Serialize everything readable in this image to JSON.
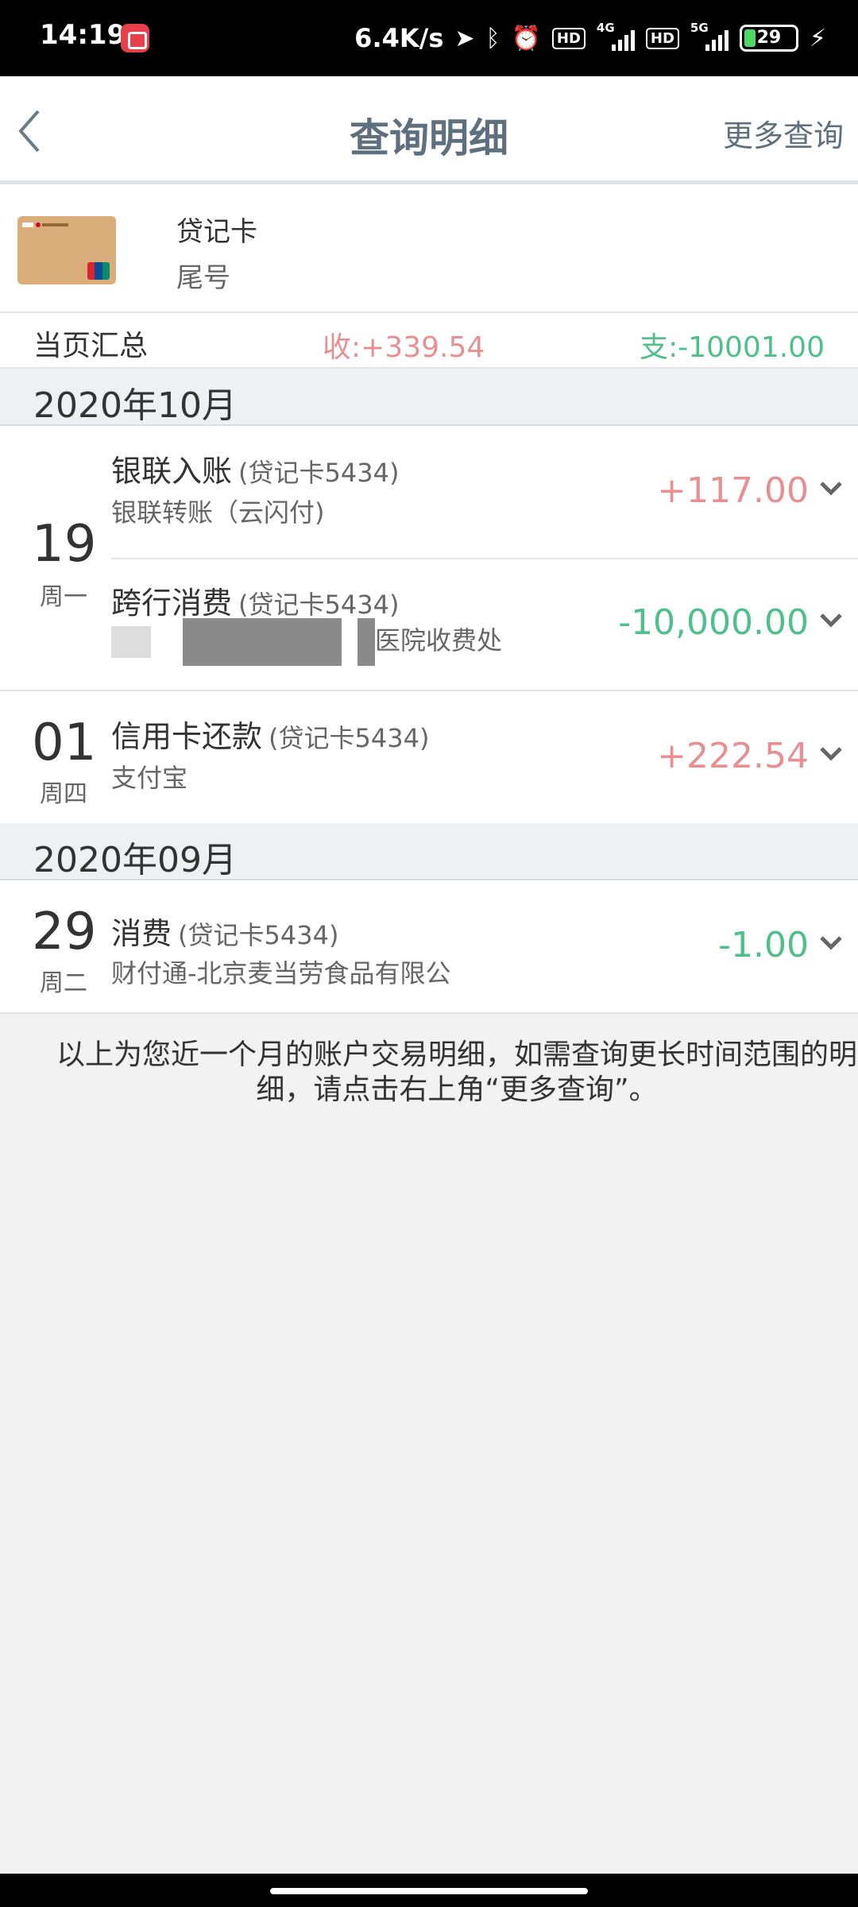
{
  "status_bar": {
    "time": "14:19",
    "speed": "6.4K/s",
    "hd1": "HD",
    "net1": "4G",
    "hd2": "HD",
    "net2": "5G",
    "battery": "29",
    "battery_level": 0.29,
    "icons": [
      "location-icon",
      "bluetooth-icon",
      "alarm-icon",
      "charging-icon"
    ]
  },
  "nav": {
    "title": "查询明细",
    "more_label": "更多查询"
  },
  "card": {
    "type": "贷记卡",
    "tail_label": "尾号"
  },
  "summary": {
    "label": "当页汇总",
    "income": "收:+339.54",
    "expense": "支:-10001.00"
  },
  "months": [
    {
      "label": "2020年10月",
      "days": [
        {
          "day": "19",
          "weekday": "周一",
          "transactions": [
            {
              "title": "银联入账",
              "card": "(贷记卡5434)",
              "desc": "银联转账（云闪付)",
              "amount": "+117.00",
              "kind": "income"
            },
            {
              "title": "跨行消费",
              "card": "(贷记卡5434)",
              "desc": "医院收费处",
              "amount": "-10,000.00",
              "kind": "expense"
            }
          ]
        },
        {
          "day": "01",
          "weekday": "周四",
          "transactions": [
            {
              "title": "信用卡还款",
              "card": "(贷记卡5434)",
              "desc": "支付宝",
              "amount": "+222.54",
              "kind": "income"
            }
          ]
        }
      ]
    },
    {
      "label": "2020年09月",
      "days": [
        {
          "day": "29",
          "weekday": "周二",
          "transactions": [
            {
              "title": "消费",
              "card": "(贷记卡5434)",
              "desc": "财付通-北京麦当劳食品有限公",
              "amount": "-1.00",
              "kind": "expense"
            }
          ]
        }
      ]
    }
  ],
  "footer_note": "以上为您近一个月的账户交易明细，如需查询更长时间范围的明细，请点击右上角“更多查询”。",
  "colors": {
    "income": "#e88f92",
    "expense": "#4fbf8b",
    "nav_text": "#5e6f7d"
  }
}
